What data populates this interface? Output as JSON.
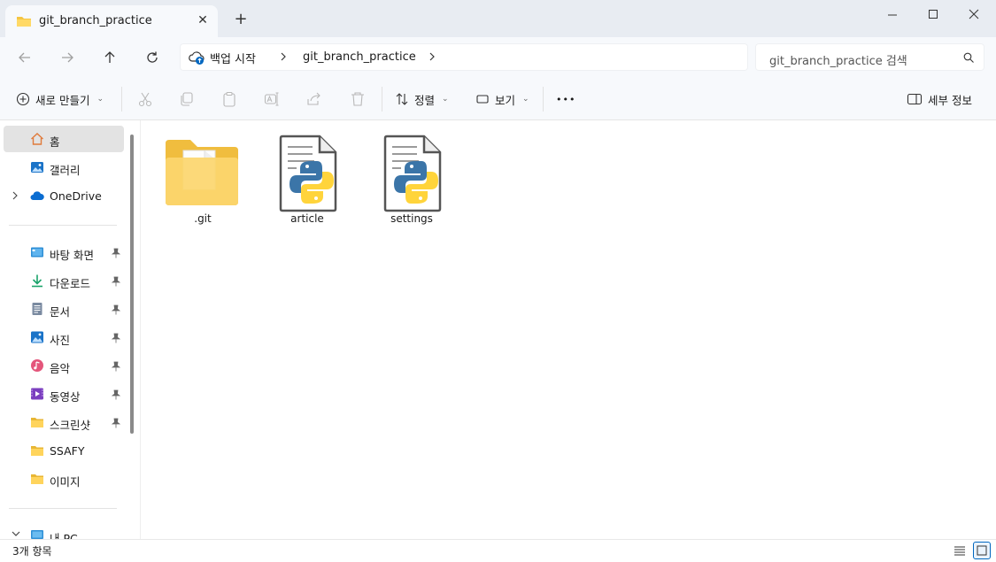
{
  "window": {
    "tab_title": "git_branch_practice",
    "new_tab_symbol": "+",
    "close_tab_symbol": "✕"
  },
  "address": {
    "home_crumb": "백업 시작",
    "crumb": "git_branch_practice",
    "search_placeholder": "git_branch_practice 검색"
  },
  "toolbar": {
    "new_label": "새로 만들기",
    "sort_label": "정렬",
    "view_label": "보기",
    "more_symbol": "•••",
    "details_label": "세부 정보"
  },
  "sidebar": {
    "items": [
      {
        "label": "홈",
        "icon": "home-icon"
      },
      {
        "label": "갤러리",
        "icon": "gallery-icon"
      },
      {
        "label": "OneDrive",
        "icon": "cloud-icon"
      },
      {
        "label": "바탕 화면",
        "icon": "desktop-icon"
      },
      {
        "label": "다운로드",
        "icon": "download-icon"
      },
      {
        "label": "문서",
        "icon": "document-icon"
      },
      {
        "label": "사진",
        "icon": "pictures-icon"
      },
      {
        "label": "음악",
        "icon": "music-icon"
      },
      {
        "label": "동영상",
        "icon": "video-icon"
      },
      {
        "label": "스크린샷",
        "icon": "folder-icon"
      },
      {
        "label": "SSAFY",
        "icon": "folder-icon"
      },
      {
        "label": "이미지",
        "icon": "folder-icon"
      },
      {
        "label": "내 PC",
        "icon": "pc-icon"
      }
    ]
  },
  "files": [
    {
      "name": ".git",
      "type": "folder"
    },
    {
      "name": "article",
      "type": "python"
    },
    {
      "name": "settings",
      "type": "python"
    }
  ],
  "status": {
    "item_count": "3개 항목"
  },
  "colors": {
    "accent": "#0067c0",
    "folder": "#f5c542",
    "python_blue": "#3b75a8",
    "python_yellow": "#ffd43b"
  }
}
